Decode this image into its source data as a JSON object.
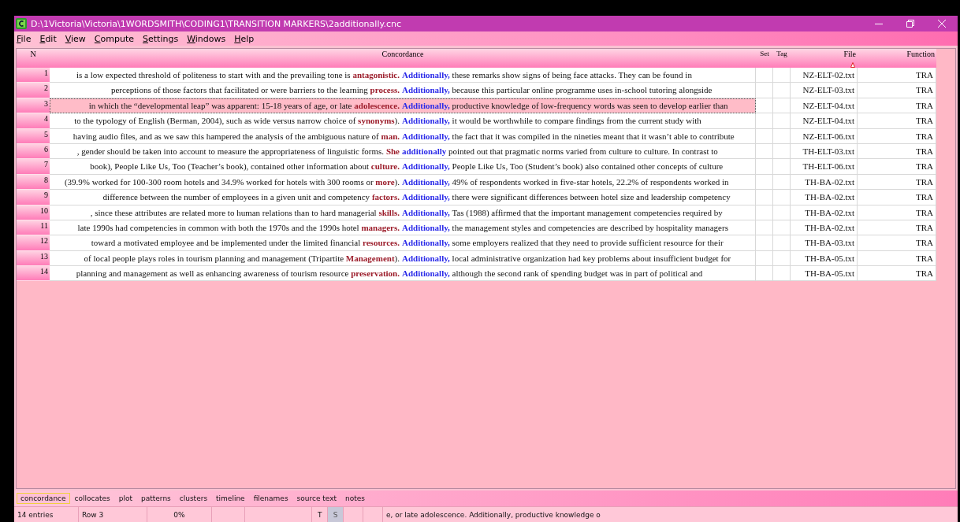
{
  "window": {
    "title": "D:\\1Victoria\\Victoria\\1WORDSMITH\\CODING1\\TRANSITION MARKERS\\2additionally.cnc"
  },
  "menu": [
    "File",
    "Edit",
    "View",
    "Compute",
    "Settings",
    "Windows",
    "Help"
  ],
  "table": {
    "columns": [
      {
        "label": "N"
      },
      {
        "label": "Concordance"
      },
      {
        "label": "Set"
      },
      {
        "label": "Tag"
      },
      {
        "label": "File",
        "sorted": true
      },
      {
        "label": "Function"
      }
    ],
    "rows": [
      {
        "n": "1",
        "left": "is a low expected threshold of politeness to start with and the prevailing tone is",
        "keyword": "antagonistic.",
        "after_keyword": "",
        "node": "Additionally,",
        "right": "these remarks show signs of being face attacks. They can be found in",
        "file": "NZ-ELT-02.txt",
        "function": "TRA",
        "selected": false
      },
      {
        "n": "2",
        "left": "perceptions of those factors that facilitated or were barriers to the learning",
        "keyword": "process.",
        "after_keyword": "",
        "node": "Additionally,",
        "right": "because this particular online programme uses in-school tutoring alongside",
        "file": "NZ-ELT-03.txt",
        "function": "TRA",
        "selected": false
      },
      {
        "n": "3",
        "left": "in which the “developmental leap” was apparent: 15-18 years of age, or late",
        "keyword": "adolescence.",
        "after_keyword": "",
        "node": "Additionally,",
        "right": "productive knowledge of low-frequency words was seen to develop earlier than",
        "file": "NZ-ELT-04.txt",
        "function": "TRA",
        "selected": true
      },
      {
        "n": "4",
        "left": "to the typology of English (Berman, 2004), such as wide versus narrow choice of",
        "keyword": "synonyms",
        "after_keyword": ").",
        "node": "Additionally,",
        "right": "it would be worthwhile to compare findings from the current study with",
        "file": "NZ-ELT-04.txt",
        "function": "TRA",
        "selected": false
      },
      {
        "n": "5",
        "left": "having audio files, and as we saw this hampered the analysis of the ambiguous nature of",
        "keyword": "man.",
        "after_keyword": "",
        "node": "Additionally,",
        "right": "the fact that it was compiled in the nineties meant that it wasn’t able to contribute",
        "file": "NZ-ELT-06.txt",
        "function": "TRA",
        "selected": false
      },
      {
        "n": "6",
        "left": ", gender should be taken into account to measure the appropriateness of linguistic forms.",
        "keyword": "She",
        "after_keyword": "",
        "node": "additionally",
        "right": "pointed out that pragmatic norms varied from culture to culture. In contrast to",
        "file": "TH-ELT-03.txt",
        "function": "TRA",
        "selected": false
      },
      {
        "n": "7",
        "left": "book), People Like Us, Too (Teacher’s book), contained other information about",
        "keyword": "culture.",
        "after_keyword": "",
        "node": "Additionally,",
        "right": "People Like Us, Too (Student’s book) also contained other concepts of culture",
        "file": "TH-ELT-06.txt",
        "function": "TRA",
        "selected": false
      },
      {
        "n": "8",
        "left": "(39.9% worked for 100-300 room hotels and 34.9% worked for hotels with 300 rooms or",
        "keyword": "more",
        "after_keyword": ").",
        "node": "Additionally,",
        "right": "49% of respondents worked in five-star hotels, 22.2% of respondents worked in",
        "file": "TH-BA-02.txt",
        "function": "TRA",
        "selected": false
      },
      {
        "n": "9",
        "left": "difference between the number of employees in a given unit and competency",
        "keyword": "factors.",
        "after_keyword": "",
        "node": "Additionally,",
        "right": "there were significant differences between hotel size and leadership competency",
        "file": "TH-BA-02.txt",
        "function": "TRA",
        "selected": false
      },
      {
        "n": "10",
        "left": ", since these attributes are related more to human relations than to hard managerial",
        "keyword": "skills.",
        "after_keyword": "",
        "node": "Additionally,",
        "right": "Tas (1988) affirmed that the important management competencies required by",
        "file": "TH-BA-02.txt",
        "function": "TRA",
        "selected": false
      },
      {
        "n": "11",
        "left": "late 1990s had competencies in common with both the 1970s and the 1990s hotel",
        "keyword": "managers.",
        "after_keyword": "",
        "node": "Additionally,",
        "right": "the management styles and competencies are described by hospitality managers",
        "file": "TH-BA-02.txt",
        "function": "TRA",
        "selected": false
      },
      {
        "n": "12",
        "left": "toward a motivated employee and be implemented under the limited financial",
        "keyword": "resources.",
        "after_keyword": "",
        "node": "Additionally,",
        "right": "some employers realized that they need to provide sufficient resource for their",
        "file": "TH-BA-03.txt",
        "function": "TRA",
        "selected": false
      },
      {
        "n": "13",
        "left": "of local people plays roles in tourism planning and management (Tripartite",
        "keyword": "Management",
        "after_keyword": ").",
        "node": "Additionally,",
        "right": "local administrative organization had key problems about insufficient budget for",
        "file": "TH-BA-05.txt",
        "function": "TRA",
        "selected": false
      },
      {
        "n": "14",
        "left": "planning and management as well as enhancing awareness of tourism resource",
        "keyword": "preservation.",
        "after_keyword": "",
        "node": "Additionally,",
        "right": "although the second rank of spending budget was in part of political and",
        "file": "TH-BA-05.txt",
        "function": "TRA",
        "selected": false
      }
    ]
  },
  "tabs": [
    {
      "label": "concordance",
      "selected": true
    },
    {
      "label": "collocates",
      "selected": false
    },
    {
      "label": "plot",
      "selected": false
    },
    {
      "label": "patterns",
      "selected": false
    },
    {
      "label": "clusters",
      "selected": false
    },
    {
      "label": "timeline",
      "selected": false
    },
    {
      "label": "filenames",
      "selected": false
    },
    {
      "label": "source text",
      "selected": false
    },
    {
      "label": "notes",
      "selected": false
    }
  ],
  "status_bar": {
    "entries": "14 entries",
    "row": "Row 3",
    "percent": "0%",
    "t": "T",
    "s": "S",
    "preview": "e, or late adolescence. Additionally, productive knowledge o"
  }
}
